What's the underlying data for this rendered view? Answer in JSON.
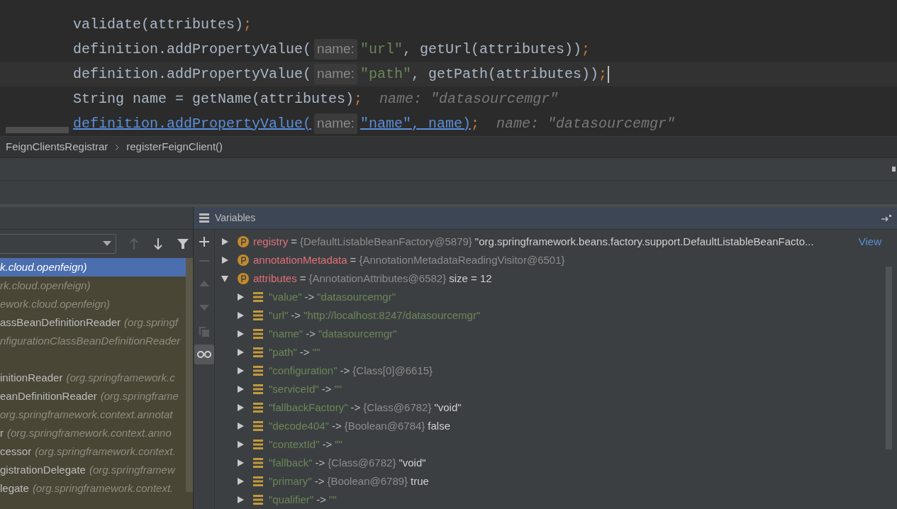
{
  "editor": {
    "lines": [
      {
        "current": false,
        "segments": [
          {
            "kind": "plain",
            "text": "validate(attributes)"
          },
          {
            "kind": "punct",
            "text": ";"
          }
        ]
      },
      {
        "current": false,
        "segments": [
          {
            "kind": "plain",
            "text": "definition.addPropertyValue("
          },
          {
            "kind": "hint",
            "text": "name:"
          },
          {
            "kind": "string",
            "text": "\"url\""
          },
          {
            "kind": "plain",
            "text": ", getUrl(attributes))"
          },
          {
            "kind": "punct",
            "text": ";"
          }
        ]
      },
      {
        "current": true,
        "segments": [
          {
            "kind": "plain",
            "text": "definition.addPropertyValue("
          },
          {
            "kind": "hint",
            "text": "name:"
          },
          {
            "kind": "string",
            "text": "\"path\""
          },
          {
            "kind": "plain",
            "text": ", getPath(attributes))"
          },
          {
            "kind": "punct",
            "text": ";"
          }
        ]
      },
      {
        "current": false,
        "segments": [
          {
            "kind": "plain",
            "text": "String name = getName(attributes)"
          },
          {
            "kind": "punct",
            "text": ";"
          },
          {
            "kind": "inlay",
            "text": "name: \"datasourcemgr\""
          }
        ]
      },
      {
        "current": false,
        "segments": [
          {
            "kind": "link",
            "text": "definition.addPropertyValue("
          },
          {
            "kind": "hint",
            "text": "name:"
          },
          {
            "kind": "link",
            "text": "\"name\", name)"
          },
          {
            "kind": "punct",
            "text": ";"
          },
          {
            "kind": "inlay",
            "text": "name: \"datasourcemgr\""
          }
        ]
      }
    ]
  },
  "breadcrumbs": [
    "FeignClientsRegistrar",
    "registerFeignClient()"
  ],
  "frames": [
    {
      "location": "k.cloud.openfeign)",
      "selected": true
    },
    {
      "location": "rk.cloud.openfeign)",
      "selected": false
    },
    {
      "location": "ework.cloud.openfeign)",
      "selected": false
    },
    {
      "method": "assBeanDefinitionReader",
      "location": "(org.springf",
      "selected": false
    },
    {
      "location": "nfigurationClassBeanDefinitionReader",
      "selected": false
    },
    {
      "selected": false
    },
    {
      "method": "initionReader",
      "location": "(org.springframework.c",
      "selected": false
    },
    {
      "method": "eanDefinitionReader",
      "location": "(org.springframe",
      "selected": false
    },
    {
      "location": "org.springframework.context.annotat",
      "selected": false
    },
    {
      "method": "r",
      "location": "(org.springframework.context.anno",
      "selected": false
    },
    {
      "method": "cessor",
      "location": "(org.springframework.context.",
      "selected": false
    },
    {
      "method": "gistrationDelegate",
      "location": "(org.springframew",
      "selected": false
    },
    {
      "method": "legate",
      "location": "(org.springframework.context.",
      "selected": false
    }
  ],
  "variables": {
    "title": "Variables",
    "items": [
      {
        "kind": "field",
        "name": "registry",
        "expanded": false,
        "parts": [
          {
            "kind": "op",
            "text": "="
          },
          {
            "kind": "object",
            "text": "{DefaultListableBeanFactory@5879}"
          },
          {
            "kind": "plain",
            "text": "\"org.springframework.beans.factory.support.DefaultListableBeanFacto..."
          },
          {
            "kind": "link",
            "text": "View"
          }
        ]
      },
      {
        "kind": "field",
        "name": "annotationMetadata",
        "expanded": false,
        "parts": [
          {
            "kind": "op",
            "text": "="
          },
          {
            "kind": "object",
            "text": "{AnnotationMetadataReadingVisitor@6501}"
          }
        ]
      },
      {
        "kind": "field",
        "name": "attributes",
        "expanded": true,
        "parts": [
          {
            "kind": "op",
            "text": "="
          },
          {
            "kind": "object",
            "text": "{AnnotationAttributes@6582}"
          },
          {
            "kind": "plain",
            "text": "size = 12"
          }
        ],
        "children": [
          {
            "kind": "entry",
            "name": "\"value\"",
            "expanded": false,
            "parts": [
              {
                "kind": "op",
                "text": "->"
              },
              {
                "kind": "string",
                "text": "\"datasourcemgr\""
              }
            ]
          },
          {
            "kind": "entry",
            "name": "\"url\"",
            "expanded": false,
            "parts": [
              {
                "kind": "op",
                "text": "->"
              },
              {
                "kind": "string",
                "text": "\"http://localhost:8247/datasourcemgr\""
              }
            ]
          },
          {
            "kind": "entry",
            "name": "\"name\"",
            "expanded": false,
            "parts": [
              {
                "kind": "op",
                "text": "->"
              },
              {
                "kind": "string",
                "text": "\"datasourcemgr\""
              }
            ]
          },
          {
            "kind": "entry",
            "name": "\"path\"",
            "expanded": false,
            "parts": [
              {
                "kind": "op",
                "text": "->"
              },
              {
                "kind": "string",
                "text": "\"\""
              }
            ]
          },
          {
            "kind": "entry",
            "name": "\"configuration\"",
            "expanded": false,
            "parts": [
              {
                "kind": "op",
                "text": "->"
              },
              {
                "kind": "object",
                "text": "{Class[0]@6615}"
              }
            ]
          },
          {
            "kind": "entry",
            "name": "\"serviceId\"",
            "expanded": false,
            "parts": [
              {
                "kind": "op",
                "text": "->"
              },
              {
                "kind": "string",
                "text": "\"\""
              }
            ]
          },
          {
            "kind": "entry",
            "name": "\"fallbackFactory\"",
            "expanded": false,
            "parts": [
              {
                "kind": "op",
                "text": "->"
              },
              {
                "kind": "object",
                "text": "{Class@6782}"
              },
              {
                "kind": "plain",
                "text": "\"void\""
              }
            ]
          },
          {
            "kind": "entry",
            "name": "\"decode404\"",
            "expanded": false,
            "parts": [
              {
                "kind": "op",
                "text": "->"
              },
              {
                "kind": "object",
                "text": "{Boolean@6784}"
              },
              {
                "kind": "plain",
                "text": "false"
              }
            ]
          },
          {
            "kind": "entry",
            "name": "\"contextId\"",
            "expanded": false,
            "parts": [
              {
                "kind": "op",
                "text": "->"
              },
              {
                "kind": "string",
                "text": "\"\""
              }
            ]
          },
          {
            "kind": "entry",
            "name": "\"fallback\"",
            "expanded": false,
            "parts": [
              {
                "kind": "op",
                "text": "->"
              },
              {
                "kind": "object",
                "text": "{Class@6782}"
              },
              {
                "kind": "plain",
                "text": "\"void\""
              }
            ]
          },
          {
            "kind": "entry",
            "name": "\"primary\"",
            "expanded": false,
            "parts": [
              {
                "kind": "op",
                "text": "->"
              },
              {
                "kind": "object",
                "text": "{Boolean@6789}"
              },
              {
                "kind": "plain",
                "text": "true"
              }
            ]
          },
          {
            "kind": "entry",
            "name": "\"qualifier\"",
            "expanded": false,
            "parts": [
              {
                "kind": "op",
                "text": "->"
              },
              {
                "kind": "string",
                "text": "\"\""
              }
            ]
          }
        ]
      }
    ]
  }
}
